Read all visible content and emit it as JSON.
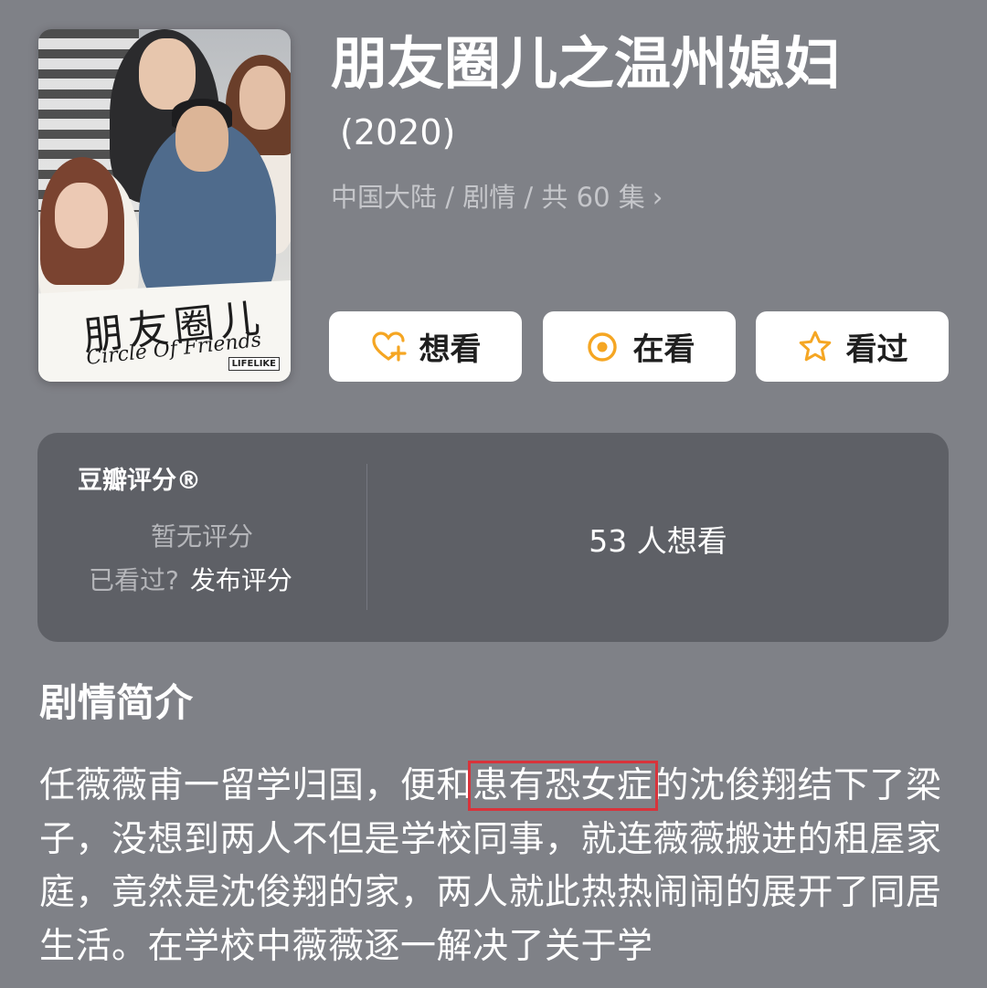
{
  "header": {
    "title": "朋友圈儿之温州媳妇",
    "year": "(2020)",
    "meta": "中国大陆 / 剧情 / 共 60 集",
    "meta_chevron": "›"
  },
  "poster": {
    "title_cn": "朋友圈儿",
    "title_en": "Circle Of Friends",
    "brand": "LIFELIKE"
  },
  "actions": {
    "want_label": "想看",
    "watching_label": "在看",
    "watched_label": "看过"
  },
  "rating": {
    "label": "豆瓣评分®",
    "no_rating": "暂无评分",
    "seen_prompt": "已看过?",
    "publish_label": "发布评分",
    "want_count": "53 人想看"
  },
  "synopsis": {
    "title": "剧情简介",
    "text_before": "任薇薇甫一留学归国，便和",
    "highlight": "患有恐女症",
    "text_after": "的沈俊翔结下了梁子，没想到两人不但是学校同事，就连薇薇搬进的租屋家庭，竟然是沈俊翔的家，两人就此热热闹闹的展开了同居生活。在学校中薇薇逐一解决了关于学"
  },
  "colors": {
    "background": "#7f8187",
    "card": "#5e6066",
    "accent": "#f5a623",
    "highlight_box": "#d8333b"
  },
  "icons": {
    "want": "heart-plus-icon",
    "watching": "target-circle-icon",
    "watched": "star-outline-icon"
  }
}
